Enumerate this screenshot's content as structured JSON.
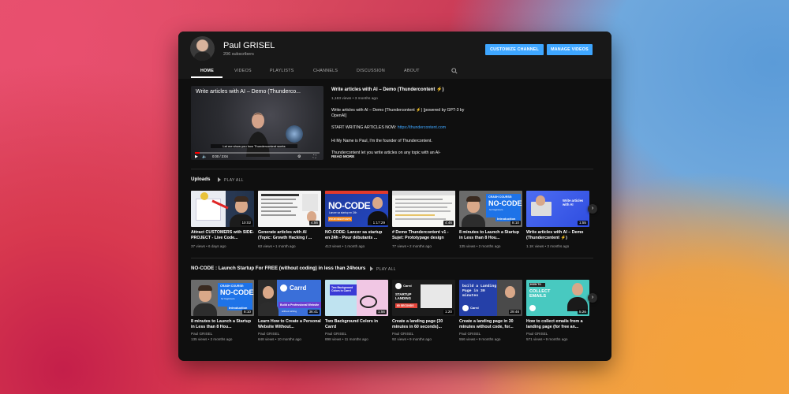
{
  "channel": {
    "name": "Paul GRISEL",
    "subscribers": "206 subscribers",
    "customize_label": "CUSTOMIZE CHANNEL",
    "manage_label": "MANAGE VIDEOS"
  },
  "tabs": [
    {
      "label": "HOME",
      "active": true
    },
    {
      "label": "VIDEOS"
    },
    {
      "label": "PLAYLISTS"
    },
    {
      "label": "CHANNELS"
    },
    {
      "label": "DISCUSSION"
    },
    {
      "label": "ABOUT"
    }
  ],
  "featured": {
    "player_title": "Write articles with AI – Demo (Thunderco...",
    "caption": "Let me show you how Thundercontent works",
    "time": "0:00 / 3:04",
    "title": "Write articles with AI – Demo (Thundercontent ⚡)",
    "meta": "1,183 views • 3 months ago",
    "desc1": "Write articles with AI – Demo (Thundercontent ⚡) [powered by GPT-3 by OpenAI]",
    "desc2_prefix": "START WRITING ARTICLES NOW: ",
    "desc2_link": "https://thundercontent.com",
    "desc3": "Hi My Name is Paul, I'm the founder of Thundercontent.",
    "desc4": "Thundercontent let you write articles on any topic with an AI-",
    "read_more": "READ MORE"
  },
  "uploads": {
    "title": "Uploads",
    "play_all": "PLAY ALL",
    "videos": [
      {
        "title": "Attract CUSTOMERS with SIDE-PROJECT - Live Code...",
        "meta": "37 views • 6 days ago",
        "duration": "10:02"
      },
      {
        "title": "Generate articles with AI (Topic: Growth Hacking / ...",
        "meta": "63 views • 1 month ago",
        "duration": "4:56"
      },
      {
        "title": "NO-CODE: Lancer sa startup en 24h - Pour débutants ...",
        "meta": "413 views • 1 month ago",
        "duration": "1:17:29"
      },
      {
        "title": "# Demo Thundercontent v1 - Sujet: Prototypage design",
        "meta": "77 views • 2 months ago",
        "duration": "4:46"
      },
      {
        "title": "8 minutes to Launch a Startup in Less than 8 Hou...",
        "meta": "135 views • 2 months ago",
        "duration": "8:10"
      },
      {
        "title": "Write articles with AI – Demo (Thundercontent ⚡)",
        "meta": "1.1K views • 3 months ago",
        "duration": "1:55"
      }
    ]
  },
  "playlist": {
    "title": "NO-CODE : Launch Startup For FREE (without coding) in less than 24hours",
    "play_all": "PLAY ALL",
    "videos": [
      {
        "title": "8 minutes to Launch a Startup in Less than 8 Hou...",
        "author": "Paul GRISEL",
        "meta": "135 views • 2 months ago",
        "duration": "8:10"
      },
      {
        "title": "Learn How to Create a Personal Website Without...",
        "author": "Paul GRISEL",
        "meta": "648 views • 10 months ago",
        "duration": "36:41"
      },
      {
        "title": "Two Background Colors in Carrd",
        "author": "Paul GRISEL",
        "meta": "898 views • 11 months ago",
        "duration": "1:56"
      },
      {
        "title": "Create a landing page (30 minutes in 60 seconds)...",
        "author": "Paul GRISEL",
        "meta": "92 views • 9 months ago",
        "duration": "1:20"
      },
      {
        "title": "Create a landing page in 30 minutes without code, for...",
        "author": "Paul GRISEL",
        "meta": "556 views • 9 months ago",
        "duration": "29:46"
      },
      {
        "title": "How to collect emails from a landing page (for free an...",
        "author": "Paul GRISEL",
        "meta": "571 views • 9 months ago",
        "duration": "5:26"
      }
    ]
  },
  "thumb_text": {
    "nocode_big": "NO-CODE",
    "nocode_sub": "Lancer sa startup en 24h",
    "pour_debutants": "POUR DÉBUTANTS",
    "crash_course": "CRASH COURSE:",
    "beginners": "for beginners",
    "introduction": "Introduction",
    "write_ai": "Write articles with AI",
    "carrd": "Carrd",
    "build_site": "Build a Professional Website",
    "no_coding": "without writing",
    "two_bg": "Two Background Colors in Carrd",
    "startup_landing": "STARTUP LANDING",
    "sixty_sec": "60 SECONDS",
    "build_landing": "build a Landing Page in 30 minutes",
    "how_to": "HOW TO",
    "collect_emails": "COLLECT EMAILS"
  },
  "colors": {
    "accent": "#3ea6ff",
    "window_bg": "#0f0f0f",
    "header_bg": "#181818",
    "progress": "#ff0000"
  },
  "icons": [
    "search-icon",
    "play-icon",
    "volume-icon",
    "settings-icon",
    "fullscreen-icon",
    "chevron-right-icon"
  ]
}
